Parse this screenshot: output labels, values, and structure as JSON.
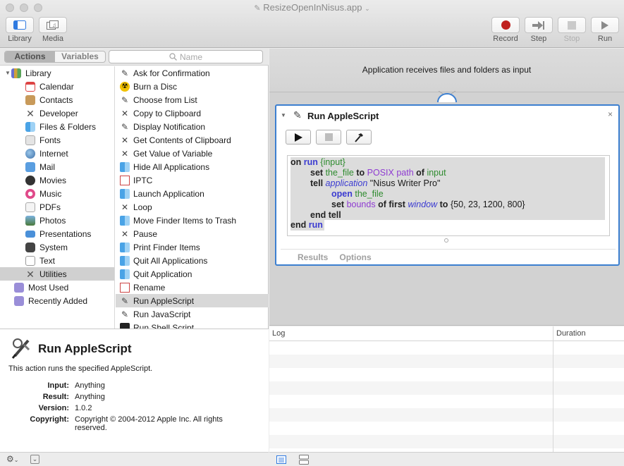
{
  "window": {
    "title": "ResizeOpenInNisus.app"
  },
  "toolbar": {
    "library_label": "Library",
    "media_label": "Media",
    "record_label": "Record",
    "step_label": "Step",
    "stop_label": "Stop",
    "run_label": "Run"
  },
  "tabs": {
    "actions_label": "Actions",
    "variables_label": "Variables"
  },
  "search": {
    "placeholder": "Name"
  },
  "library": {
    "root_label": "Library",
    "items": [
      {
        "label": "Calendar"
      },
      {
        "label": "Contacts"
      },
      {
        "label": "Developer"
      },
      {
        "label": "Files & Folders"
      },
      {
        "label": "Fonts"
      },
      {
        "label": "Internet"
      },
      {
        "label": "Mail"
      },
      {
        "label": "Movies"
      },
      {
        "label": "Music"
      },
      {
        "label": "PDFs"
      },
      {
        "label": "Photos"
      },
      {
        "label": "Presentations"
      },
      {
        "label": "System"
      },
      {
        "label": "Text"
      },
      {
        "label": "Utilities"
      }
    ],
    "most_used_label": "Most Used",
    "recently_added_label": "Recently Added"
  },
  "actions": [
    {
      "label": "Ask for Confirmation"
    },
    {
      "label": "Burn a Disc"
    },
    {
      "label": "Choose from List"
    },
    {
      "label": "Copy to Clipboard"
    },
    {
      "label": "Display Notification"
    },
    {
      "label": "Get Contents of Clipboard"
    },
    {
      "label": "Get Value of Variable"
    },
    {
      "label": "Hide All Applications"
    },
    {
      "label": "IPTC"
    },
    {
      "label": "Launch Application"
    },
    {
      "label": "Loop"
    },
    {
      "label": "Move Finder Items to Trash"
    },
    {
      "label": "Pause"
    },
    {
      "label": "Print Finder Items"
    },
    {
      "label": "Quit All Applications"
    },
    {
      "label": "Quit Application"
    },
    {
      "label": "Rename"
    },
    {
      "label": "Run AppleScript"
    },
    {
      "label": "Run JavaScript"
    },
    {
      "label": "Run Shell Script"
    }
  ],
  "description": {
    "title": "Run AppleScript",
    "text": "This action runs the specified AppleScript.",
    "input_key": "Input:",
    "input_value": "Anything",
    "result_key": "Result:",
    "result_value": "Anything",
    "version_key": "Version:",
    "version_value": "1.0.2",
    "copyright_key": "Copyright:",
    "copyright_value": "Copyright © 2004-2012 Apple Inc.  All rights reserved."
  },
  "workflow": {
    "input_text": "Application receives files and folders as input",
    "action_title": "Run AppleScript",
    "close_glyph": "×",
    "code": {
      "l1_on": "on",
      "l1_run": "run",
      "l1_input": "{input}",
      "l2_set": "set",
      "l2_var": "the_file",
      "l2_to": "to",
      "l2_cls": "POSIX path",
      "l2_of": "of",
      "l2_input": "input",
      "l3_tell": "tell",
      "l3_app": "application",
      "l3_str": "\"Nisus Writer Pro\"",
      "l4_open": "open",
      "l4_var": "the_file",
      "l5_set": "set",
      "l5_bounds": "bounds",
      "l5_of": "of",
      "l5_first": "first",
      "l5_window": "window",
      "l5_to": "to",
      "l5_val": "{50, 23, 1200, 800}",
      "l6_end": "end tell",
      "l7_end": "end",
      "l7_run": "run"
    },
    "results_label": "Results",
    "options_label": "Options"
  },
  "log": {
    "log_header": "Log",
    "duration_header": "Duration"
  }
}
